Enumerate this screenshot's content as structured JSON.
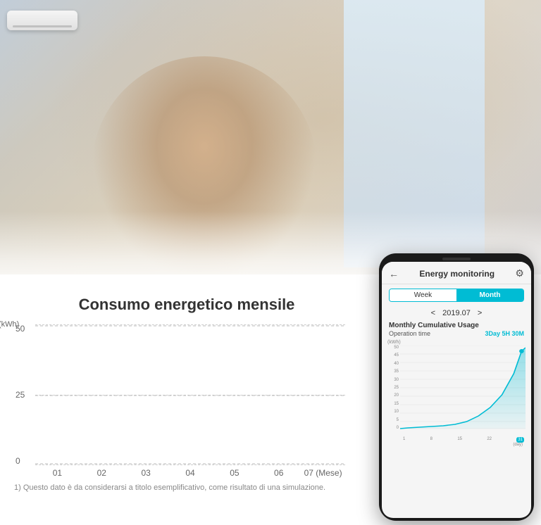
{
  "background": {
    "photo_description": "Woman looking at smartphone in modern living room with AC unit"
  },
  "chart": {
    "title": "Consumo energetico mensile",
    "y_axis_unit": "(kWh)",
    "y_labels": [
      "50",
      "25",
      "0"
    ],
    "x_labels": [
      "01",
      "02",
      "03",
      "04",
      "05",
      "06",
      "07 (Mese)"
    ],
    "footnote": "1) Questo dato è da considerarsi a titolo esemplificativo, come risultato di una simulazione."
  },
  "phone": {
    "header": {
      "back_icon": "←",
      "title": "Energy monitoring",
      "settings_icon": "⚙"
    },
    "tabs": [
      {
        "label": "Week",
        "active": false
      },
      {
        "label": "Month",
        "active": true
      }
    ],
    "month_nav": {
      "prev_icon": "<",
      "current": "2019.07",
      "next_icon": ">"
    },
    "section_title": "Monthly Cumulative Usage",
    "operation_time_label": "Operation time",
    "operation_time_value": "3Day 5H 30M",
    "chart": {
      "y_unit": "(kWh)",
      "y_ticks": [
        "50",
        "45",
        "40",
        "35",
        "30",
        "25",
        "20",
        "15",
        "10",
        "5",
        "0"
      ],
      "x_ticks": [
        "1",
        "8",
        "15",
        "22",
        "31"
      ],
      "x_highlight": "31",
      "day_label": "(day)"
    }
  }
}
